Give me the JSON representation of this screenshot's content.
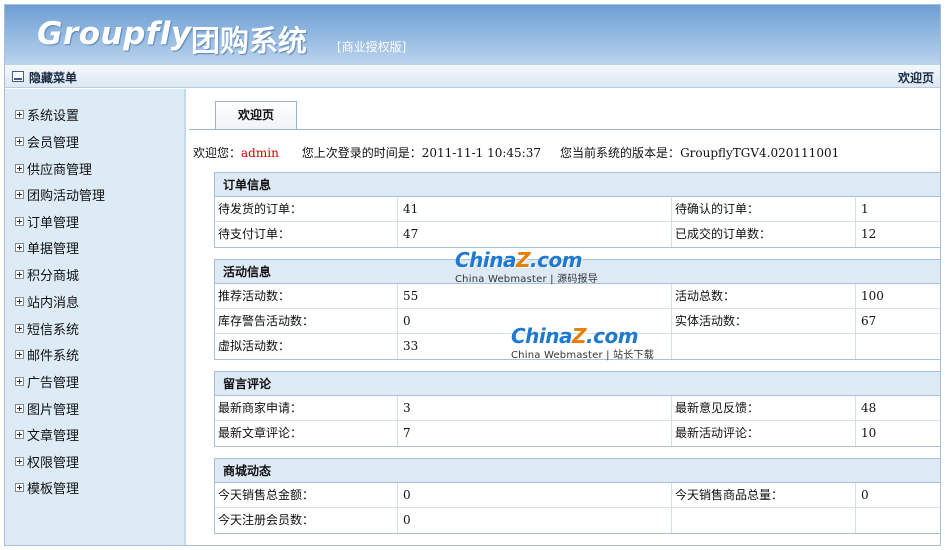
{
  "header": {
    "logo_text": "Groupfly",
    "logo_cn": "团购系统",
    "license_tag": "[商业授权版]"
  },
  "toolbar": {
    "hide_menu_label": "隐藏菜单",
    "welcome_right": "欢迎页"
  },
  "sidebar": {
    "items": [
      {
        "label": "系统设置"
      },
      {
        "label": "会员管理"
      },
      {
        "label": "供应商管理"
      },
      {
        "label": "团购活动管理"
      },
      {
        "label": "订单管理"
      },
      {
        "label": "单据管理"
      },
      {
        "label": "积分商城"
      },
      {
        "label": "站内消息"
      },
      {
        "label": "短信系统"
      },
      {
        "label": "邮件系统"
      },
      {
        "label": "广告管理"
      },
      {
        "label": "图片管理"
      },
      {
        "label": "文章管理"
      },
      {
        "label": "权限管理"
      },
      {
        "label": "模板管理"
      }
    ]
  },
  "main": {
    "tab_label": "欢迎页",
    "info": {
      "welcome_prefix": "欢迎您：",
      "username": "admin",
      "last_login_label": "您上次登录的时间是：",
      "last_login_time": "2011-11-1 10:45:37",
      "version_label": "您当前系统的版本是：",
      "version": "GroupflyTGV4.020111001"
    },
    "panels": [
      {
        "title": "订单信息",
        "rows": [
          {
            "l1": "待发货的订单：",
            "v1": "41",
            "l2": "待确认的订单：",
            "v2": "1"
          },
          {
            "l1": "待支付订单：",
            "v1": "47",
            "l2": "已成交的订单数：",
            "v2": "12"
          }
        ]
      },
      {
        "title": "活动信息",
        "rows": [
          {
            "l1": "推荐活动数：",
            "v1": "55",
            "l2": "活动总数：",
            "v2": "100"
          },
          {
            "l1": "库存警告活动数：",
            "v1": "0",
            "l2": "实体活动数：",
            "v2": "67"
          },
          {
            "l1": "虚拟活动数：",
            "v1": "33",
            "l2": "",
            "v2": ""
          }
        ]
      },
      {
        "title": "留言评论",
        "rows": [
          {
            "l1": "最新商家申请：",
            "v1": "3",
            "l2": "最新意见反馈：",
            "v2": "48"
          },
          {
            "l1": "最新文章评论：",
            "v1": "7",
            "l2": "最新活动评论：",
            "v2": "10"
          }
        ]
      },
      {
        "title": "商城动态",
        "rows": [
          {
            "l1": "今天销售总金额：",
            "v1": "0",
            "l2": "今天销售商品总量：",
            "v2": "0"
          },
          {
            "l1": "今天注册会员数：",
            "v1": "0",
            "l2": "",
            "v2": ""
          }
        ]
      }
    ]
  },
  "watermarks": [
    {
      "brand_a": "China",
      "brand_z": "Z",
      "brand_b": ".com",
      "sub": "China Webmaster | 源码报导"
    },
    {
      "brand_a": "China",
      "brand_z": "Z",
      "brand_b": ".com",
      "sub": "China Webmaster | 站长下载"
    }
  ],
  "colors": {
    "header_blue": "#6e9fd3",
    "sidebar_bg": "#ddebf6",
    "panel_title_bg": "#dde9f5",
    "username_red": "#cc0000"
  }
}
